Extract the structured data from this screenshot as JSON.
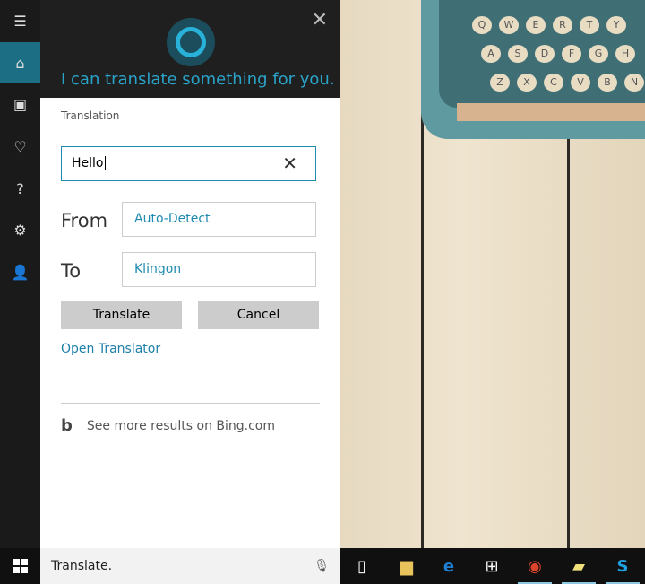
{
  "cortana": {
    "prompt": "I can translate something for you.",
    "section_label": "Translation",
    "input_value": "Hello",
    "from_label": "From",
    "from_value": "Auto-Detect",
    "to_label": "To",
    "to_value": "Klingon",
    "translate_button": "Translate",
    "cancel_button": "Cancel",
    "open_translator_link": "Open Translator",
    "bing_link": "See more results on Bing.com"
  },
  "sidebar": {
    "items": [
      "menu-icon",
      "home-icon",
      "notebook-icon",
      "lightbulb-icon",
      "help-icon",
      "settings-icon",
      "feedback-icon"
    ],
    "active": "home-icon"
  },
  "taskbar": {
    "search_text": "Translate.",
    "apps": [
      "task-view-icon",
      "file-explorer-icon",
      "edge-icon",
      "store-icon",
      "chrome-icon",
      "sticky-notes-icon",
      "skype-icon"
    ]
  },
  "typewriter_keys": [
    [
      "Q",
      "W",
      "E",
      "R",
      "T",
      "Y"
    ],
    [
      "A",
      "S",
      "D",
      "F",
      "G",
      "H"
    ],
    [
      "Z",
      "X",
      "C",
      "V",
      "B",
      "N"
    ]
  ],
  "colors": {
    "accent": "#1e8ab0",
    "cortana_blue": "#29b2d9",
    "active_sidebar": "#1b6e83"
  }
}
